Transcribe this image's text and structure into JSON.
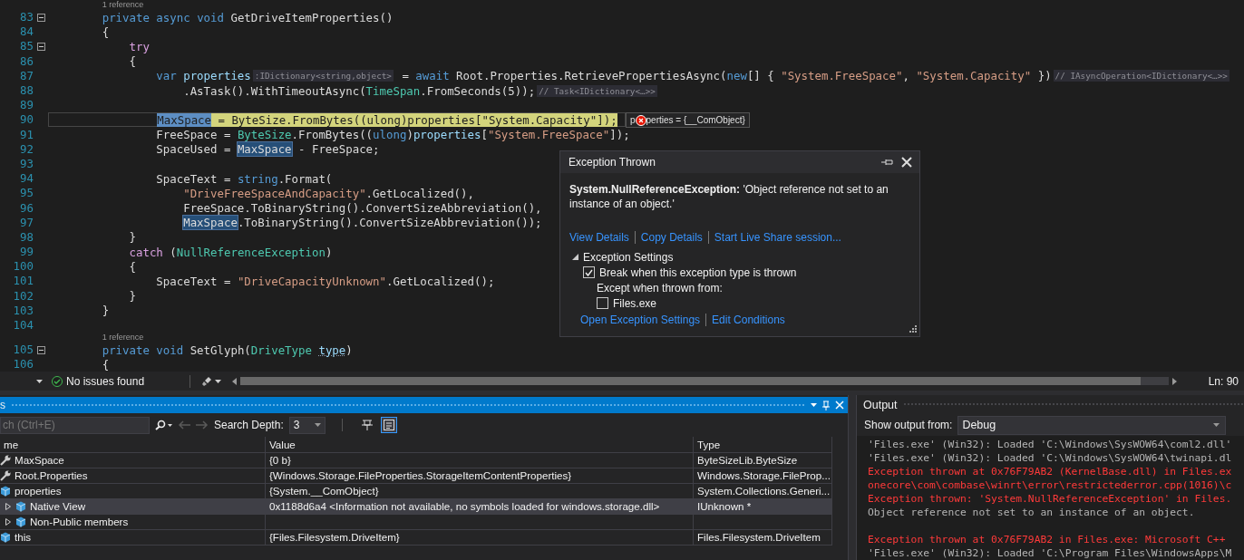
{
  "editor": {
    "lines": [
      {
        "kind": "lens",
        "text": "1 reference"
      },
      {
        "kind": "code",
        "number": "83",
        "expanded": true,
        "segs": [
          {
            "kind": "code",
            "tokens": [
              {
                "kind": "keyword",
                "text": "private "
              },
              {
                "kind": "keyword",
                "text": "async "
              },
              {
                "kind": "keyword",
                "text": "void"
              },
              {
                "kind": "plain",
                "text": " GetDriveItemProperties()"
              }
            ]
          }
        ]
      },
      {
        "kind": "code",
        "number": "84",
        "segs": [
          {
            "kind": "code",
            "tokens": [
              {
                "kind": "plain",
                "text": "{"
              }
            ]
          }
        ],
        "children": [
          {
            "kind": "code",
            "number": "85",
            "expanded": true,
            "segs": [
              {
                "kind": "code",
                "tokens": [
                  {
                    "kind": "control",
                    "text": "try"
                  }
                ]
              }
            ]
          },
          {
            "kind": "code",
            "number": "86",
            "segs": [
              {
                "kind": "code",
                "tokens": [
                  {
                    "kind": "plain",
                    "text": "{"
                  }
                ]
              }
            ],
            "children": [
              {
                "kind": "code",
                "number": "87",
                "segs": [
                  {
                    "kind": "code",
                    "tokens": [
                      {
                        "kind": "keyword",
                        "text": "var "
                      },
                      {
                        "kind": "local",
                        "text": "properties"
                      }
                    ]
                  },
                  {
                    "kind": "hint",
                    "text": ":IDictionary<string,object>"
                  },
                  {
                    "kind": "code",
                    "tokens": [
                      {
                        "kind": "plain",
                        "text": " = "
                      },
                      {
                        "kind": "keyword",
                        "text": "await"
                      },
                      {
                        "kind": "plain",
                        "text": " Root.Properties.RetrievePropertiesAsync("
                      },
                      {
                        "kind": "keyword",
                        "text": "new"
                      },
                      {
                        "kind": "plain",
                        "text": "[] { "
                      },
                      {
                        "kind": "string",
                        "text": "\"System.FreeSpace\""
                      },
                      {
                        "kind": "plain",
                        "text": ", "
                      },
                      {
                        "kind": "string",
                        "text": "\"System.Capacity\""
                      },
                      {
                        "kind": "plain",
                        "text": " })"
                      }
                    ]
                  },
                  {
                    "kind": "hint",
                    "text": "// IAsyncOperation<IDictionary<…>>"
                  }
                ],
                "children": [
                  {
                    "kind": "code",
                    "number": "88",
                    "segs": [
                      {
                        "kind": "code",
                        "tokens": [
                          {
                            "kind": "plain",
                            "text": ".AsTask().WithTimeoutAsync("
                          },
                          {
                            "kind": "type",
                            "text": "TimeSpan"
                          },
                          {
                            "kind": "plain",
                            "text": ".FromSeconds(5));"
                          }
                        ]
                      },
                      {
                        "kind": "hint",
                        "text": "// Task<IDictionary<…>>"
                      }
                    ]
                  }
                ]
              },
              {
                "kind": "code",
                "number": "89"
              },
              {
                "kind": "code",
                "number": "90",
                "current": true,
                "segs": [
                  {
                    "kind": "cur",
                    "tokens": [
                      {
                        "kind": "selected",
                        "text": "MaxSpace"
                      },
                      {
                        "kind": "plain",
                        "text": " = ByteSize.FromBytes((ulong)properties[\"System.Capacity\"]);"
                      }
                    ]
                  }
                ]
              },
              {
                "kind": "code",
                "number": "91",
                "segs": [
                  {
                    "kind": "code",
                    "tokens": [
                      {
                        "kind": "plain",
                        "text": "FreeSpace = "
                      },
                      {
                        "kind": "type",
                        "text": "ByteSize"
                      },
                      {
                        "kind": "plain",
                        "text": ".FromBytes(("
                      },
                      {
                        "kind": "keyword",
                        "text": "ulong"
                      },
                      {
                        "kind": "plain",
                        "text": ")"
                      },
                      {
                        "kind": "local",
                        "text": "properties"
                      },
                      {
                        "kind": "plain",
                        "text": "["
                      },
                      {
                        "kind": "string",
                        "text": "\"System.FreeSpace\""
                      },
                      {
                        "kind": "plain",
                        "text": "]);"
                      }
                    ]
                  }
                ]
              },
              {
                "kind": "code",
                "number": "92",
                "segs": [
                  {
                    "kind": "code",
                    "tokens": [
                      {
                        "kind": "plain",
                        "text": "SpaceUsed = "
                      }
                    ]
                  },
                  {
                    "kind": "ref",
                    "text": "MaxSpace"
                  },
                  {
                    "kind": "code",
                    "tokens": [
                      {
                        "kind": "plain",
                        "text": " - FreeSpace;"
                      }
                    ]
                  }
                ]
              },
              {
                "kind": "code",
                "number": "93"
              },
              {
                "kind": "code",
                "number": "94",
                "segs": [
                  {
                    "kind": "code",
                    "tokens": [
                      {
                        "kind": "plain",
                        "text": "SpaceText = "
                      },
                      {
                        "kind": "keyword",
                        "text": "string"
                      },
                      {
                        "kind": "plain",
                        "text": ".Format("
                      }
                    ]
                  }
                ],
                "children": [
                  {
                    "kind": "code",
                    "number": "95",
                    "segs": [
                      {
                        "kind": "code",
                        "tokens": [
                          {
                            "kind": "string",
                            "text": "\"DriveFreeSpaceAndCapacity\""
                          },
                          {
                            "kind": "plain",
                            "text": ".GetLocalized(),"
                          }
                        ]
                      }
                    ]
                  },
                  {
                    "kind": "code",
                    "number": "96",
                    "segs": [
                      {
                        "kind": "code",
                        "tokens": [
                          {
                            "kind": "plain",
                            "text": "FreeSpace.ToBinaryString().ConvertSizeAbbreviation(),"
                          }
                        ]
                      }
                    ]
                  },
                  {
                    "kind": "code",
                    "number": "97",
                    "segs": [
                      {
                        "kind": "ref",
                        "text": "MaxSpace"
                      },
                      {
                        "kind": "code",
                        "tokens": [
                          {
                            "kind": "plain",
                            "text": ".ToBinaryString().ConvertSizeAbbreviation());"
                          }
                        ]
                      }
                    ]
                  }
                ]
              }
            ]
          },
          {
            "kind": "code",
            "number": "98",
            "segs": [
              {
                "kind": "code",
                "tokens": [
                  {
                    "kind": "plain",
                    "text": "}"
                  }
                ]
              }
            ]
          },
          {
            "kind": "code",
            "number": "99",
            "segs": [
              {
                "kind": "code",
                "tokens": [
                  {
                    "kind": "control",
                    "text": "catch"
                  },
                  {
                    "kind": "plain",
                    "text": " ("
                  },
                  {
                    "kind": "type",
                    "text": "NullReferenceException"
                  },
                  {
                    "kind": "plain",
                    "text": ")"
                  }
                ]
              }
            ]
          },
          {
            "kind": "code",
            "number": "100",
            "segs": [
              {
                "kind": "code",
                "tokens": [
                  {
                    "kind": "plain",
                    "text": "{"
                  }
                ]
              }
            ],
            "children": [
              {
                "kind": "code",
                "number": "101",
                "segs": [
                  {
                    "kind": "code",
                    "tokens": [
                      {
                        "kind": "plain",
                        "text": "SpaceText = "
                      },
                      {
                        "kind": "string",
                        "text": "\"DriveCapacityUnknown\""
                      },
                      {
                        "kind": "plain",
                        "text": ".GetLocalized();"
                      }
                    ]
                  }
                ]
              }
            ]
          },
          {
            "kind": "code",
            "number": "102",
            "segs": [
              {
                "kind": "code",
                "tokens": [
                  {
                    "kind": "plain",
                    "text": "}"
                  }
                ]
              }
            ]
          }
        ]
      },
      {
        "kind": "code",
        "number": "103",
        "segs": [
          {
            "kind": "code",
            "tokens": [
              {
                "kind": "plain",
                "text": "}"
              }
            ]
          }
        ]
      },
      {
        "kind": "code",
        "number": "104"
      },
      {
        "kind": "lens",
        "text": "1 reference"
      },
      {
        "kind": "code",
        "number": "105",
        "expanded": true,
        "segs": [
          {
            "kind": "code",
            "tokens": [
              {
                "kind": "keyword",
                "text": "private "
              },
              {
                "kind": "keyword",
                "text": "void"
              },
              {
                "kind": "plain",
                "text": " SetGlyph("
              },
              {
                "kind": "type",
                "text": "DriveType "
              },
              {
                "kind": "squiggle",
                "text": "type"
              },
              {
                "kind": "plain",
                "text": ")"
              }
            ]
          }
        ]
      },
      {
        "kind": "code",
        "number": "106",
        "segs": [
          {
            "kind": "code",
            "tokens": [
              {
                "kind": "plain",
                "text": "{"
              }
            ]
          }
        ]
      }
    ],
    "datatip": {
      "before": "p",
      "after": "perties = {__ComObject}"
    }
  },
  "exception_popup": {
    "title": "Exception Thrown",
    "message": "**System.NullReferenceException:** 'Object reference not set to an instance of an object.'",
    "links": [
      "View Details",
      "Copy Details",
      "Start Live Share session..."
    ],
    "settings": {
      "label": "Exception Settings",
      "expanded": true,
      "break_option": {
        "label": "Break when this exception type is thrown",
        "checked": true
      },
      "except_label": "Except when thrown from:",
      "modules": [
        {
          "label": "Files.exe",
          "checked": false
        }
      ],
      "links": [
        "Open Exception Settings",
        "Edit Conditions"
      ]
    }
  },
  "editor_status": {
    "issues": "No issues found",
    "position": "Ln: 90"
  },
  "locals_panel": {
    "title": "s",
    "search_placeholder": "ch (Ctrl+E)",
    "history_buttons": [
      {
        "kind": "back",
        "disabled": true
      },
      {
        "kind": "forward",
        "disabled": true
      }
    ],
    "depth_label": "Search Depth:",
    "depth_value": "3",
    "toggles": [
      {
        "kind": "filter",
        "selected": false
      },
      {
        "kind": "format",
        "selected": true
      }
    ],
    "columns": [
      "me",
      "Value",
      "Type"
    ],
    "rows": [
      {
        "kind": "property",
        "name": "MaxSpace",
        "value": "{0 b}",
        "type": "ByteSizeLib.ByteSize",
        "selected": false
      },
      {
        "kind": "property",
        "name": "Root.Properties",
        "value": "{Windows.Storage.FileProperties.StorageItemContentProperties}",
        "type": "Windows.Storage.FileProp...",
        "selected": false
      },
      {
        "kind": "local",
        "name": "properties",
        "value": "{System.__ComObject}",
        "type": "System.Collections.Generi...",
        "selected": false,
        "children": [
          {
            "kind": "local",
            "name": "Native View",
            "value": "0x1188d6a4 <Information not available, no symbols loaded for windows.storage.dll>",
            "type": "IUnknown *",
            "expanded": false,
            "selected": true
          },
          {
            "kind": "local",
            "name": "Non-Public members",
            "expanded": false,
            "selected": false
          }
        ]
      },
      {
        "kind": "local",
        "name": "this",
        "value": "{Files.Filesystem.DriveItem}",
        "type": "Files.Filesystem.DriveItem",
        "selected": false
      }
    ]
  },
  "output_panel": {
    "title": "Output",
    "source_label": "Show output from:",
    "source": "Debug",
    "lines": [
      {
        "kind": "info",
        "text": "'Files.exe' (Win32): Loaded 'C:\\Windows\\SysWOW64\\coml2.dll'"
      },
      {
        "kind": "info",
        "text": "'Files.exe' (Win32): Loaded 'C:\\Windows\\SysWOW64\\twinapi.dl"
      },
      {
        "kind": "error",
        "text": "Exception thrown at 0x76F79AB2 (KernelBase.dll) in Files.ex"
      },
      {
        "kind": "error",
        "text": "onecore\\com\\combase\\winrt\\error\\restrictederror.cpp(1016)\\c"
      },
      {
        "kind": "error",
        "text": "Exception thrown: 'System.NullReferenceException' in Files."
      },
      {
        "kind": "info",
        "text": "Object reference not set to an instance of an object."
      },
      {
        "kind": "blank"
      },
      {
        "kind": "error",
        "text": "Exception thrown at 0x76F79AB2 in Files.exe: Microsoft C++"
      },
      {
        "kind": "info",
        "text": "'Files.exe' (Win32): Loaded 'C:\\Program Files\\WindowsApps\\M"
      }
    ]
  }
}
